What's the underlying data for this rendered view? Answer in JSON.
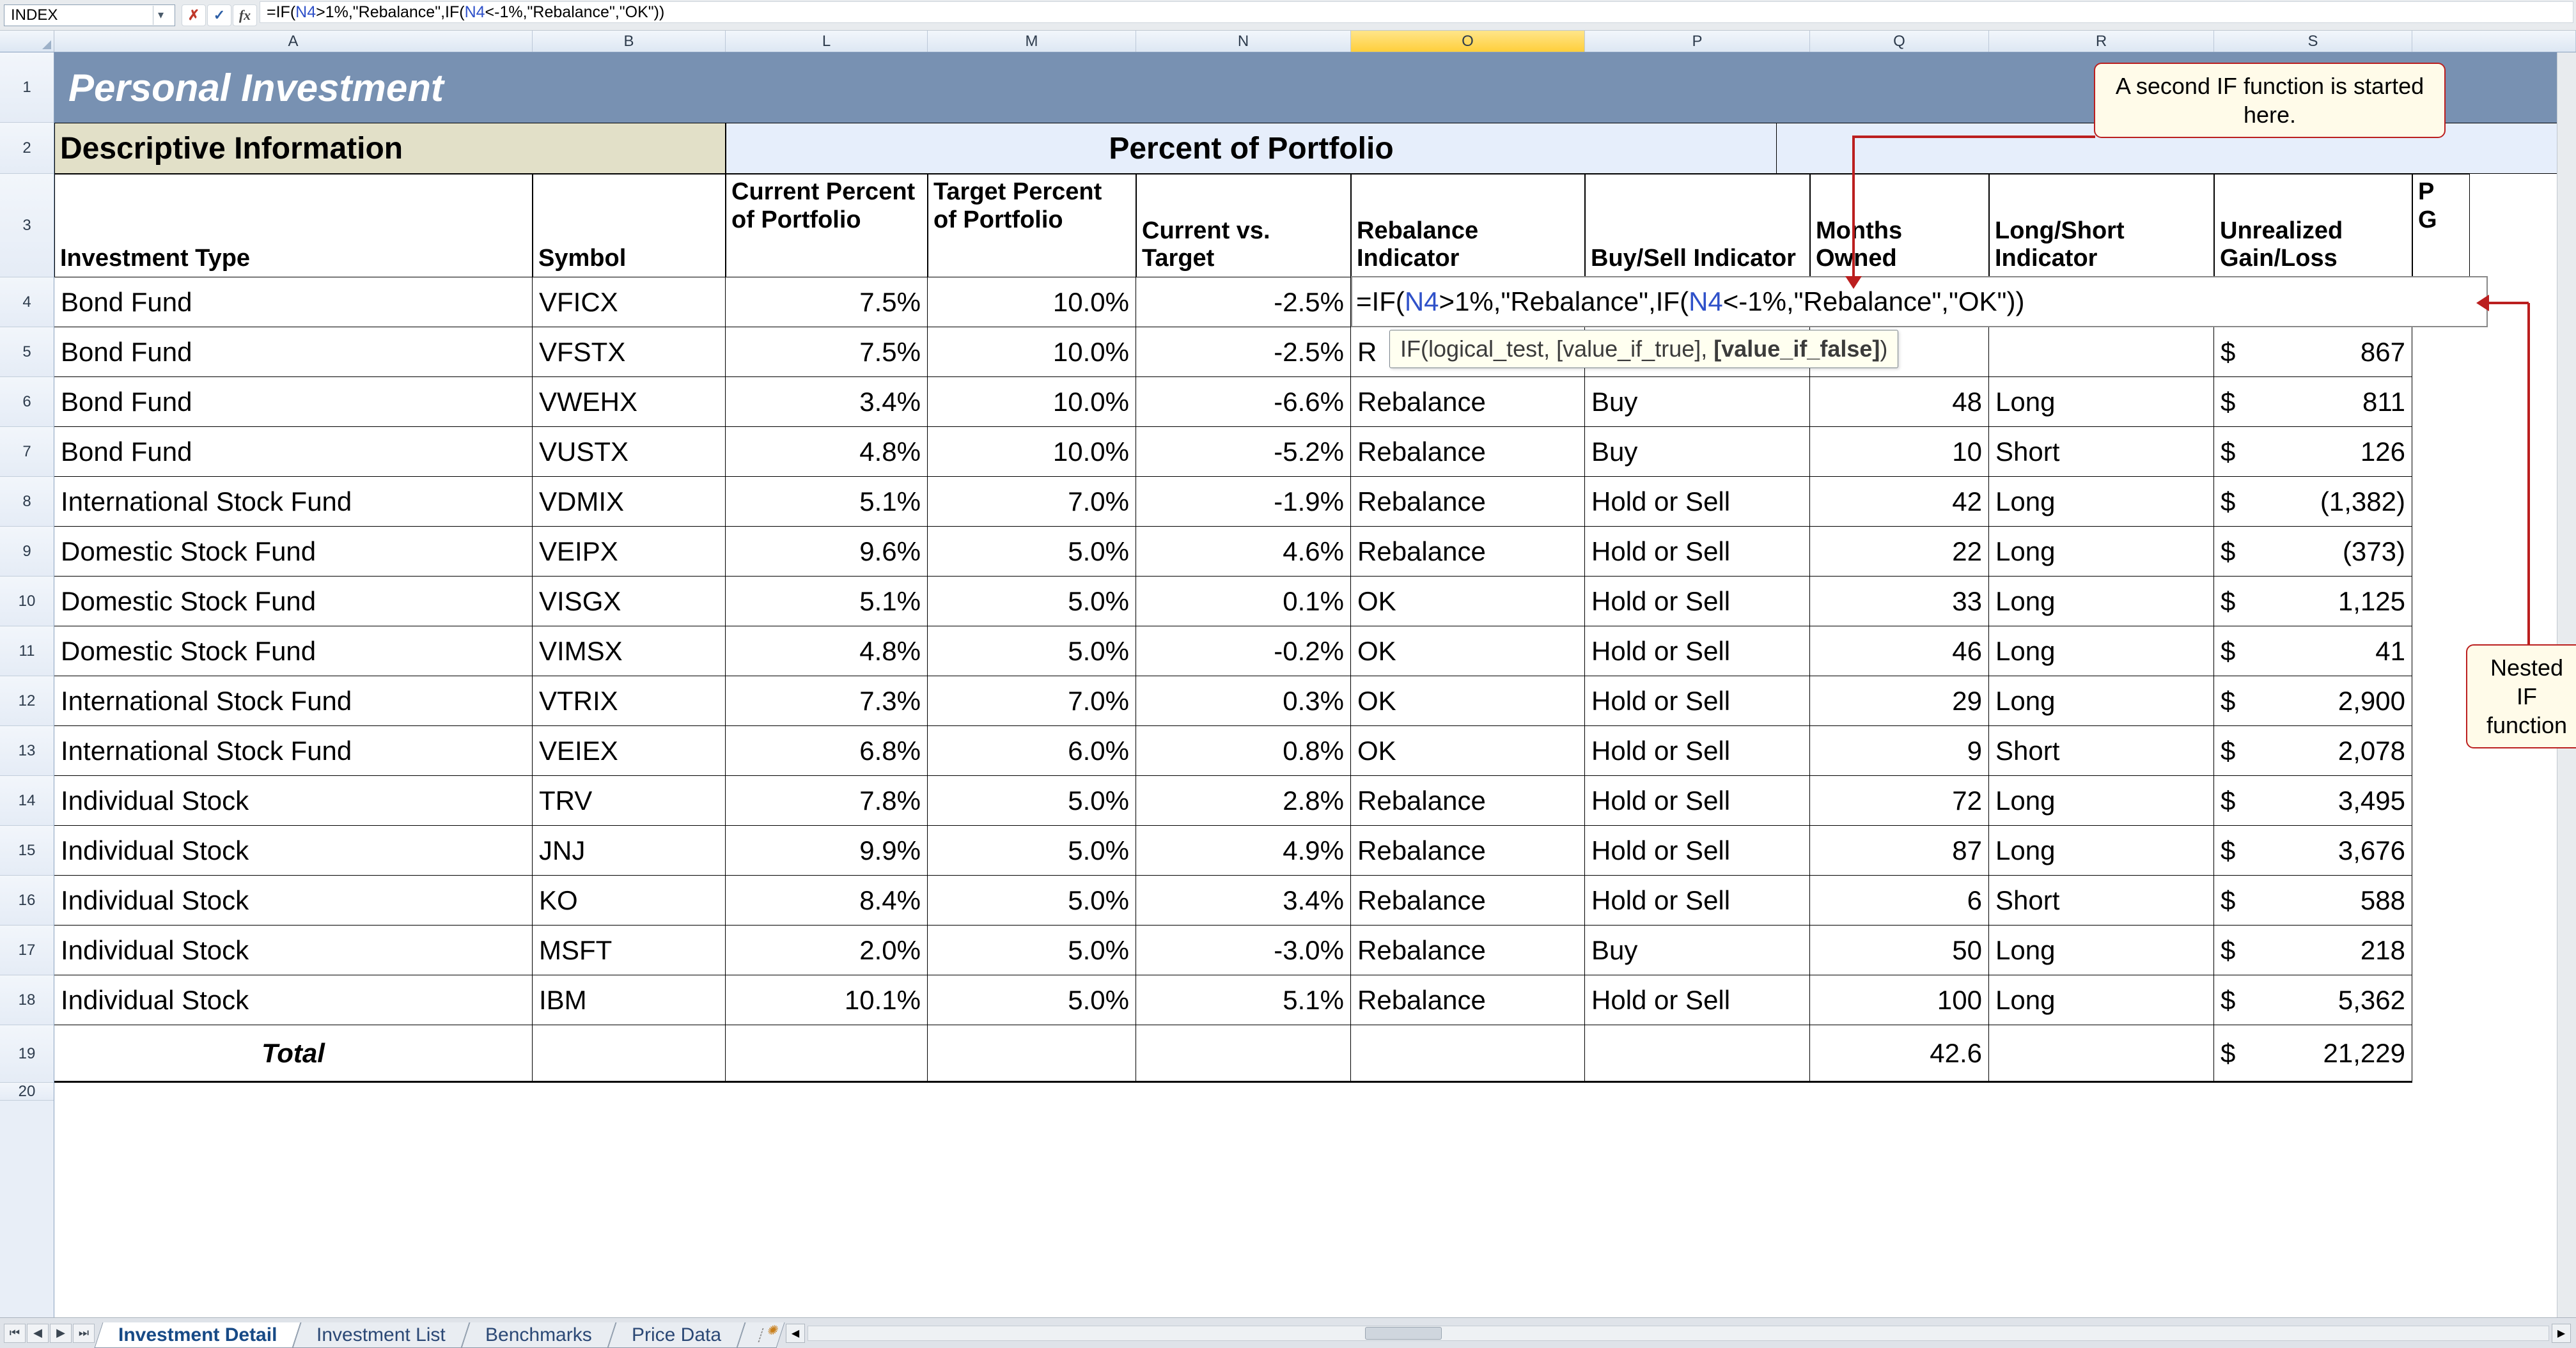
{
  "formula_bar": {
    "name_box": "INDEX",
    "cancel_glyph": "✗",
    "ok_glyph": "✓",
    "fx_label": "fx",
    "formula_plain": "=IF(N4>1%,\"Rebalance\",IF(N4<-1%,\"Rebalance\",\"OK\"))"
  },
  "columns": [
    "A",
    "B",
    "L",
    "M",
    "N",
    "O",
    "P",
    "Q",
    "R",
    "S"
  ],
  "active_col": "O",
  "active_row": "4",
  "row_numbers": [
    "1",
    "2",
    "3",
    "4",
    "5",
    "6",
    "7",
    "8",
    "9",
    "10",
    "11",
    "12",
    "13",
    "14",
    "15",
    "16",
    "17",
    "18",
    "19",
    "20"
  ],
  "title": "Personal Investment",
  "sections": {
    "descriptive": "Descriptive Information",
    "portfolio": "Percent of Portfolio"
  },
  "headers": {
    "A": "Investment Type",
    "B": "Symbol",
    "L": "Current Percent of Portfolio",
    "M": "Target Percent of Portfolio",
    "N": "Current vs. Target",
    "O": "Rebalance Indicator",
    "P": "Buy/Sell Indicator",
    "Q": "Months Owned",
    "R": "Long/Short Indicator",
    "S": "Unrealized Gain/Loss",
    "T": "P\nG"
  },
  "inline_formula": "=IF(N4>1%,\"Rebalance\",IF(N4<-1%,\"Rebalance\",\"OK\"))",
  "fn_hint": {
    "prefix": "IF(logical_test, [value_if_true], ",
    "bold": "[value_if_false]",
    "suffix": ")"
  },
  "rows": [
    {
      "A": "Bond Fund",
      "B": "VFICX",
      "L": "7.5%",
      "M": "10.0%",
      "N": "-2.5%",
      "O": "",
      "P": "",
      "Q": "",
      "R": "",
      "S": ""
    },
    {
      "A": "Bond Fund",
      "B": "VFSTX",
      "L": "7.5%",
      "M": "10.0%",
      "N": "-2.5%",
      "O": "R",
      "P": "",
      "Q": "",
      "R": "",
      "S": "867"
    },
    {
      "A": "Bond Fund",
      "B": "VWEHX",
      "L": "3.4%",
      "M": "10.0%",
      "N": "-6.6%",
      "O": "Rebalance",
      "P": "Buy",
      "Q": "48",
      "R": "Long",
      "S": "811"
    },
    {
      "A": "Bond Fund",
      "B": "VUSTX",
      "L": "4.8%",
      "M": "10.0%",
      "N": "-5.2%",
      "O": "Rebalance",
      "P": "Buy",
      "Q": "10",
      "R": "Short",
      "S": "126"
    },
    {
      "A": "International Stock Fund",
      "B": "VDMIX",
      "L": "5.1%",
      "M": "7.0%",
      "N": "-1.9%",
      "O": "Rebalance",
      "P": "Hold or Sell",
      "Q": "42",
      "R": "Long",
      "S": "(1,382)"
    },
    {
      "A": "Domestic Stock Fund",
      "B": "VEIPX",
      "L": "9.6%",
      "M": "5.0%",
      "N": "4.6%",
      "O": "Rebalance",
      "P": "Hold or Sell",
      "Q": "22",
      "R": "Long",
      "S": "(373)"
    },
    {
      "A": "Domestic Stock Fund",
      "B": "VISGX",
      "L": "5.1%",
      "M": "5.0%",
      "N": "0.1%",
      "O": "OK",
      "P": "Hold or Sell",
      "Q": "33",
      "R": "Long",
      "S": "1,125"
    },
    {
      "A": "Domestic Stock Fund",
      "B": "VIMSX",
      "L": "4.8%",
      "M": "5.0%",
      "N": "-0.2%",
      "O": "OK",
      "P": "Hold or Sell",
      "Q": "46",
      "R": "Long",
      "S": "41"
    },
    {
      "A": "International Stock Fund",
      "B": "VTRIX",
      "L": "7.3%",
      "M": "7.0%",
      "N": "0.3%",
      "O": "OK",
      "P": "Hold or Sell",
      "Q": "29",
      "R": "Long",
      "S": "2,900"
    },
    {
      "A": "International Stock Fund",
      "B": "VEIEX",
      "L": "6.8%",
      "M": "6.0%",
      "N": "0.8%",
      "O": "OK",
      "P": "Hold or Sell",
      "Q": "9",
      "R": "Short",
      "S": "2,078"
    },
    {
      "A": "Individual Stock",
      "B": "TRV",
      "L": "7.8%",
      "M": "5.0%",
      "N": "2.8%",
      "O": "Rebalance",
      "P": "Hold or Sell",
      "Q": "72",
      "R": "Long",
      "S": "3,495"
    },
    {
      "A": "Individual Stock",
      "B": "JNJ",
      "L": "9.9%",
      "M": "5.0%",
      "N": "4.9%",
      "O": "Rebalance",
      "P": "Hold or Sell",
      "Q": "87",
      "R": "Long",
      "S": "3,676"
    },
    {
      "A": "Individual Stock",
      "B": "KO",
      "L": "8.4%",
      "M": "5.0%",
      "N": "3.4%",
      "O": "Rebalance",
      "P": "Hold or Sell",
      "Q": "6",
      "R": "Short",
      "S": "588"
    },
    {
      "A": "Individual Stock",
      "B": "MSFT",
      "L": "2.0%",
      "M": "5.0%",
      "N": "-3.0%",
      "O": "Rebalance",
      "P": "Buy",
      "Q": "50",
      "R": "Long",
      "S": "218"
    },
    {
      "A": "Individual Stock",
      "B": "IBM",
      "L": "10.1%",
      "M": "5.0%",
      "N": "5.1%",
      "O": "Rebalance",
      "P": "Hold or Sell",
      "Q": "100",
      "R": "Long",
      "S": "5,362"
    }
  ],
  "totals": {
    "label": "Total",
    "Q": "42.6",
    "S": "21,229"
  },
  "callouts": {
    "top": "A second IF function is started here.",
    "right": "Nested IF function"
  },
  "tabs": {
    "items": [
      "Investment Detail",
      "Investment List",
      "Benchmarks",
      "Price Data"
    ],
    "active": 0
  }
}
